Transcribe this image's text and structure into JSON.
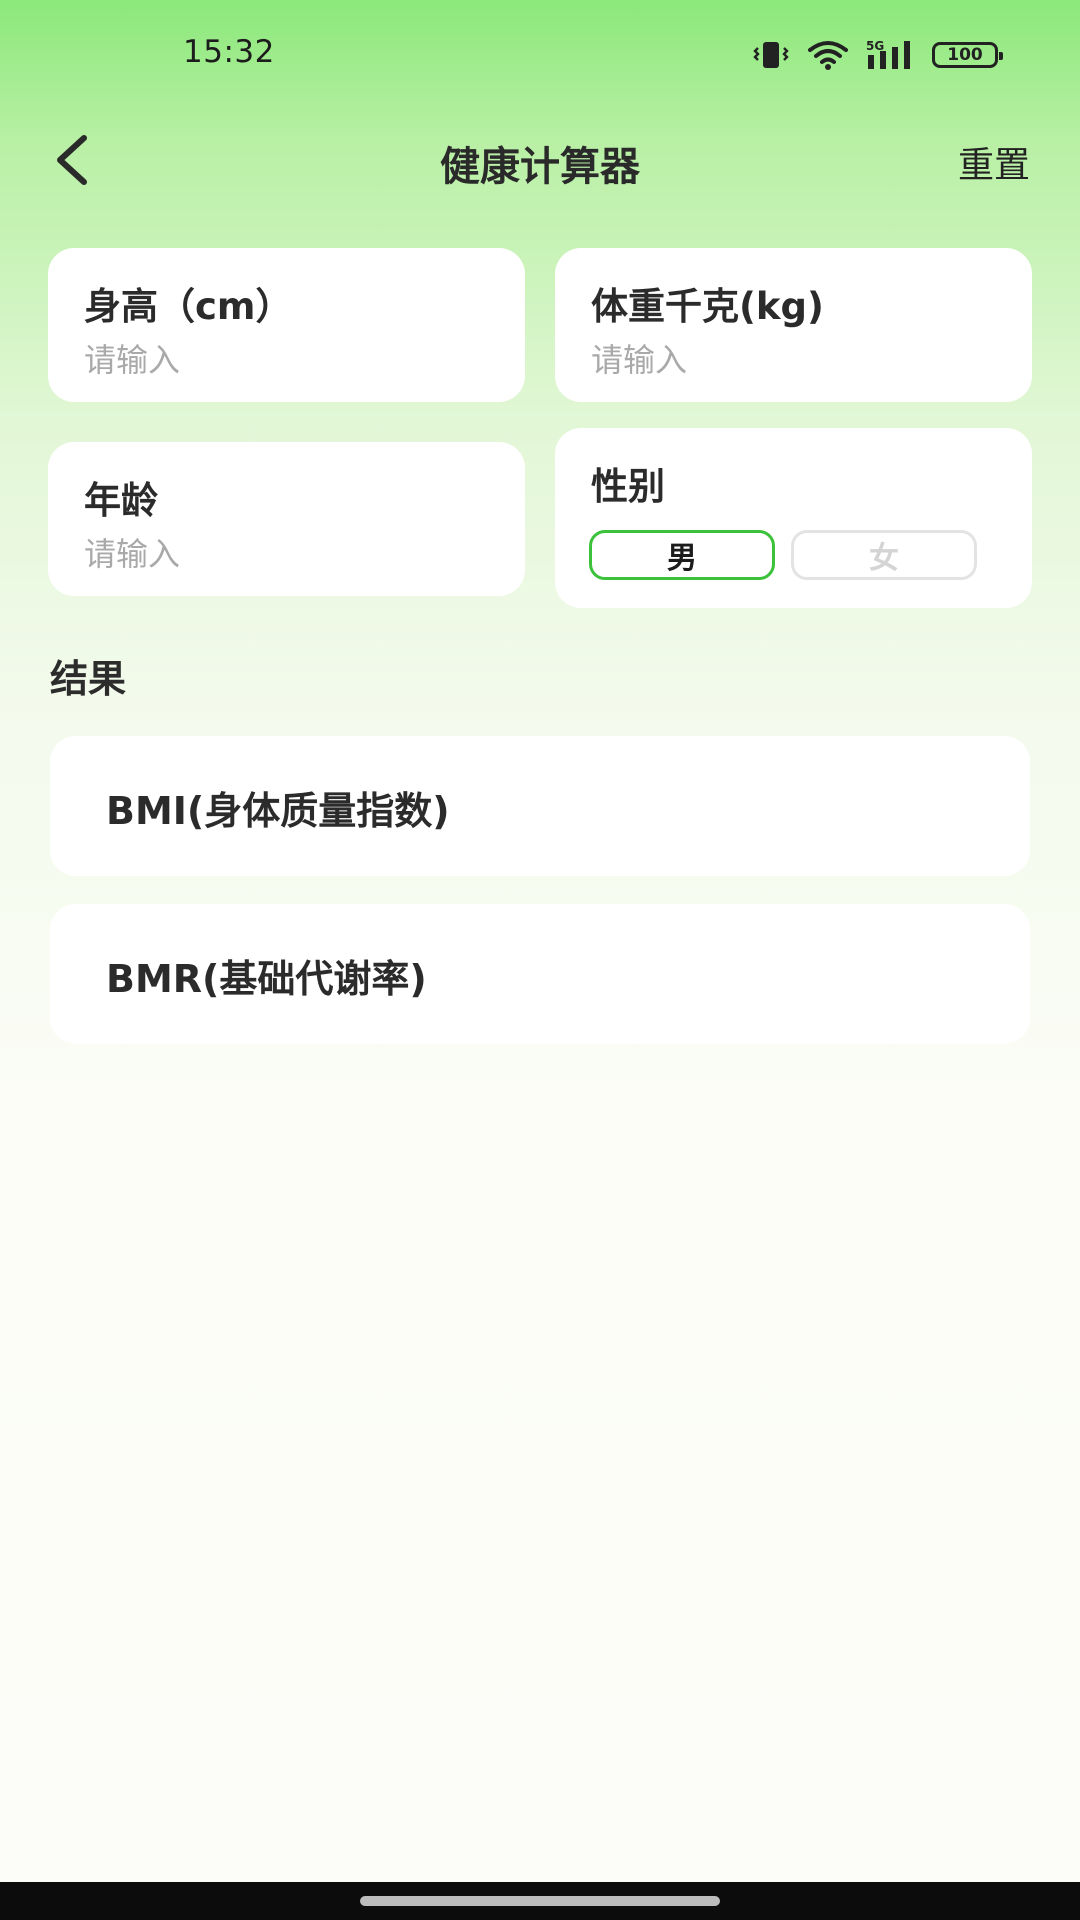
{
  "status_bar": {
    "time": "15:32",
    "network": "5G",
    "battery": "100",
    "icons": [
      "vibrate-icon",
      "wifi-icon",
      "signal-5g-icon",
      "battery-icon"
    ]
  },
  "header": {
    "title": "健康计算器",
    "reset_label": "重置",
    "back_icon": "chevron-left-icon"
  },
  "inputs": {
    "height": {
      "label": "身高（cm）",
      "value": "",
      "placeholder": "请输入"
    },
    "weight": {
      "label": "体重千克(kg)",
      "value": "",
      "placeholder": "请输入"
    },
    "age": {
      "label": "年龄",
      "value": "",
      "placeholder": "请输入"
    }
  },
  "gender": {
    "label": "性别",
    "options": [
      "男",
      "女"
    ],
    "selected": "男"
  },
  "results": {
    "title": "结果",
    "bmi_label": "BMI(身体质量指数)",
    "bmr_label": "BMR(基础代谢率)"
  },
  "colors": {
    "accent_green": "#3cc23a",
    "header_gradient_top": "#8be87a",
    "background": "#fcfdf8"
  }
}
